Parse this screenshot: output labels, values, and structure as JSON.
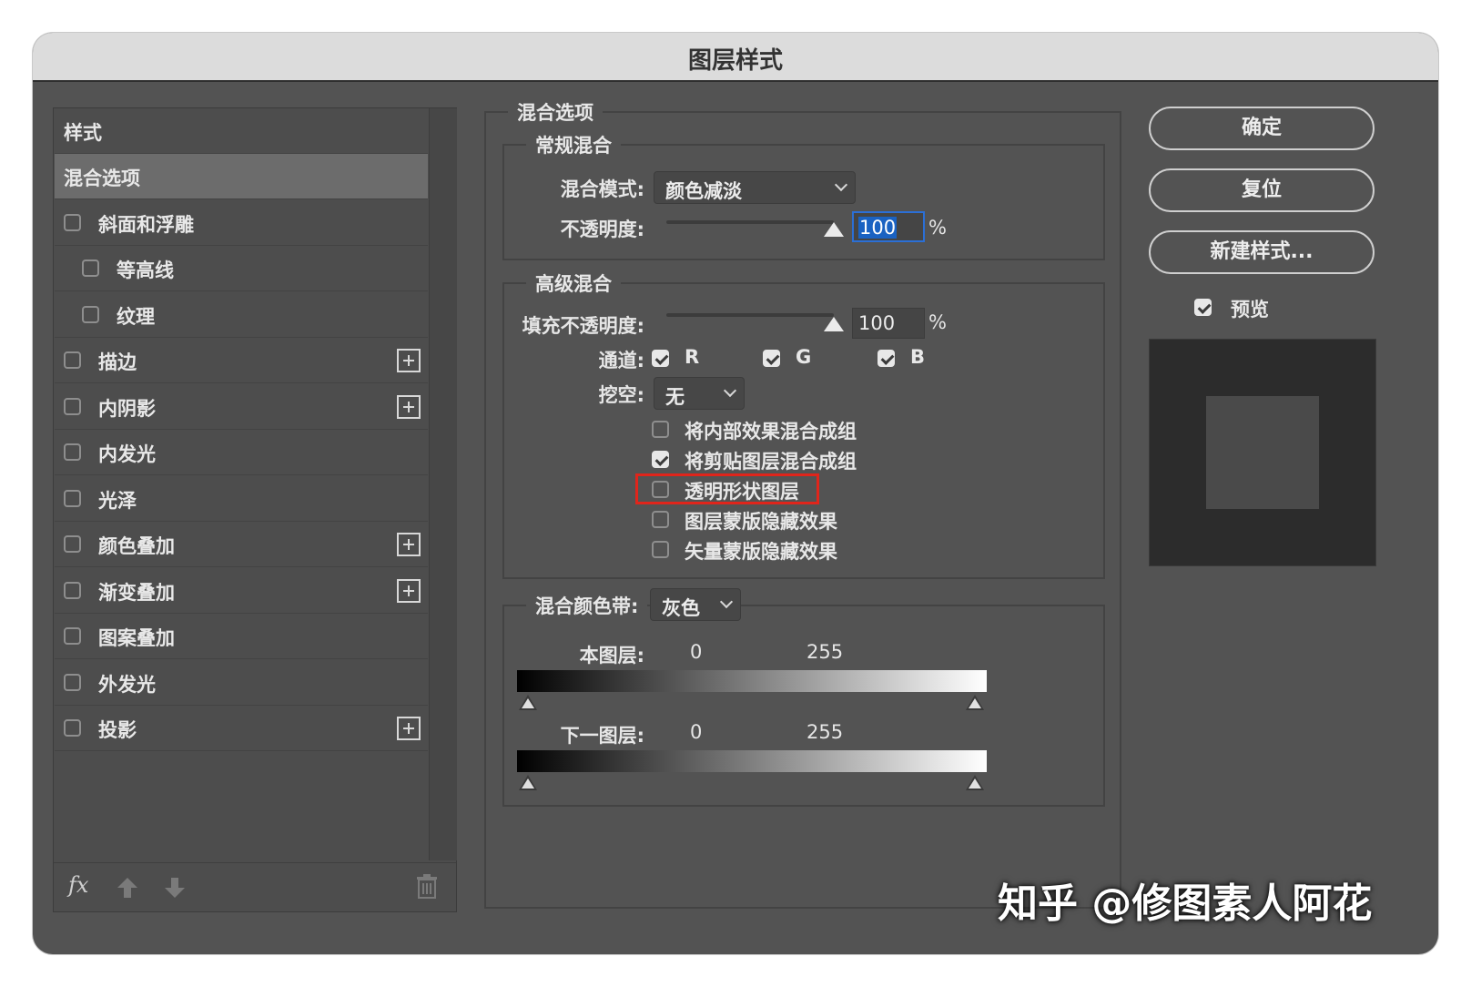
{
  "window": {
    "title": "图层样式"
  },
  "left": {
    "header": "样式",
    "items": [
      {
        "label": "混合选项",
        "selected": true,
        "checkbox": false,
        "plus": false,
        "indent": false,
        "checked": false
      },
      {
        "label": "斜面和浮雕",
        "checkbox": true,
        "plus": false,
        "indent": false,
        "checked": false
      },
      {
        "label": "等高线",
        "checkbox": true,
        "plus": false,
        "indent": true,
        "checked": false
      },
      {
        "label": "纹理",
        "checkbox": true,
        "plus": false,
        "indent": true,
        "checked": false
      },
      {
        "label": "描边",
        "checkbox": true,
        "plus": true,
        "indent": false,
        "checked": false
      },
      {
        "label": "内阴影",
        "checkbox": true,
        "plus": true,
        "indent": false,
        "checked": false
      },
      {
        "label": "内发光",
        "checkbox": true,
        "plus": false,
        "indent": false,
        "checked": false
      },
      {
        "label": "光泽",
        "checkbox": true,
        "plus": false,
        "indent": false,
        "checked": false
      },
      {
        "label": "颜色叠加",
        "checkbox": true,
        "plus": true,
        "indent": false,
        "checked": false
      },
      {
        "label": "渐变叠加",
        "checkbox": true,
        "plus": true,
        "indent": false,
        "checked": false
      },
      {
        "label": "图案叠加",
        "checkbox": true,
        "plus": false,
        "indent": false,
        "checked": false
      },
      {
        "label": "外发光",
        "checkbox": true,
        "plus": false,
        "indent": false,
        "checked": false
      },
      {
        "label": "投影",
        "checkbox": true,
        "plus": true,
        "indent": false,
        "checked": false
      }
    ],
    "footer_fx": "fx"
  },
  "blend": {
    "title": "混合选项",
    "general": {
      "title": "常规混合",
      "mode_label": "混合模式:",
      "mode_value": "颜色减淡",
      "opacity_label": "不透明度:",
      "opacity_value": "100",
      "opacity_level": 100,
      "pct": "%"
    },
    "advanced": {
      "title": "高级混合",
      "fill_label": "填充不透明度:",
      "fill_value": "100",
      "fill_level": 100,
      "pct": "%",
      "channels_label": "通道:",
      "channels": [
        {
          "label": "R",
          "checked": true
        },
        {
          "label": "G",
          "checked": true
        },
        {
          "label": "B",
          "checked": true
        }
      ],
      "knockout_label": "挖空:",
      "knockout_value": "无",
      "options": [
        {
          "label": "将内部效果混合成组",
          "checked": false
        },
        {
          "label": "将剪贴图层混合成组",
          "checked": true
        },
        {
          "label": "透明形状图层",
          "checked": false,
          "highlighted": true
        },
        {
          "label": "图层蒙版隐藏效果",
          "checked": false
        },
        {
          "label": "矢量蒙版隐藏效果",
          "checked": false
        }
      ]
    },
    "blendif": {
      "label": "混合颜色带:",
      "value": "灰色",
      "this_layer": {
        "label": "本图层:",
        "min": "0",
        "max": "255"
      },
      "underlying": {
        "label": "下一图层:",
        "min": "0",
        "max": "255"
      }
    }
  },
  "buttons": {
    "ok": "确定",
    "reset": "复位",
    "new_style": "新建样式...",
    "preview": "预览",
    "preview_checked": true
  },
  "watermark": "知乎 @修图素人阿花",
  "colors": {
    "highlight_border": "#e0251b",
    "selection_bg": "#1a62c2",
    "focus_ring": "#2b6fd6"
  }
}
